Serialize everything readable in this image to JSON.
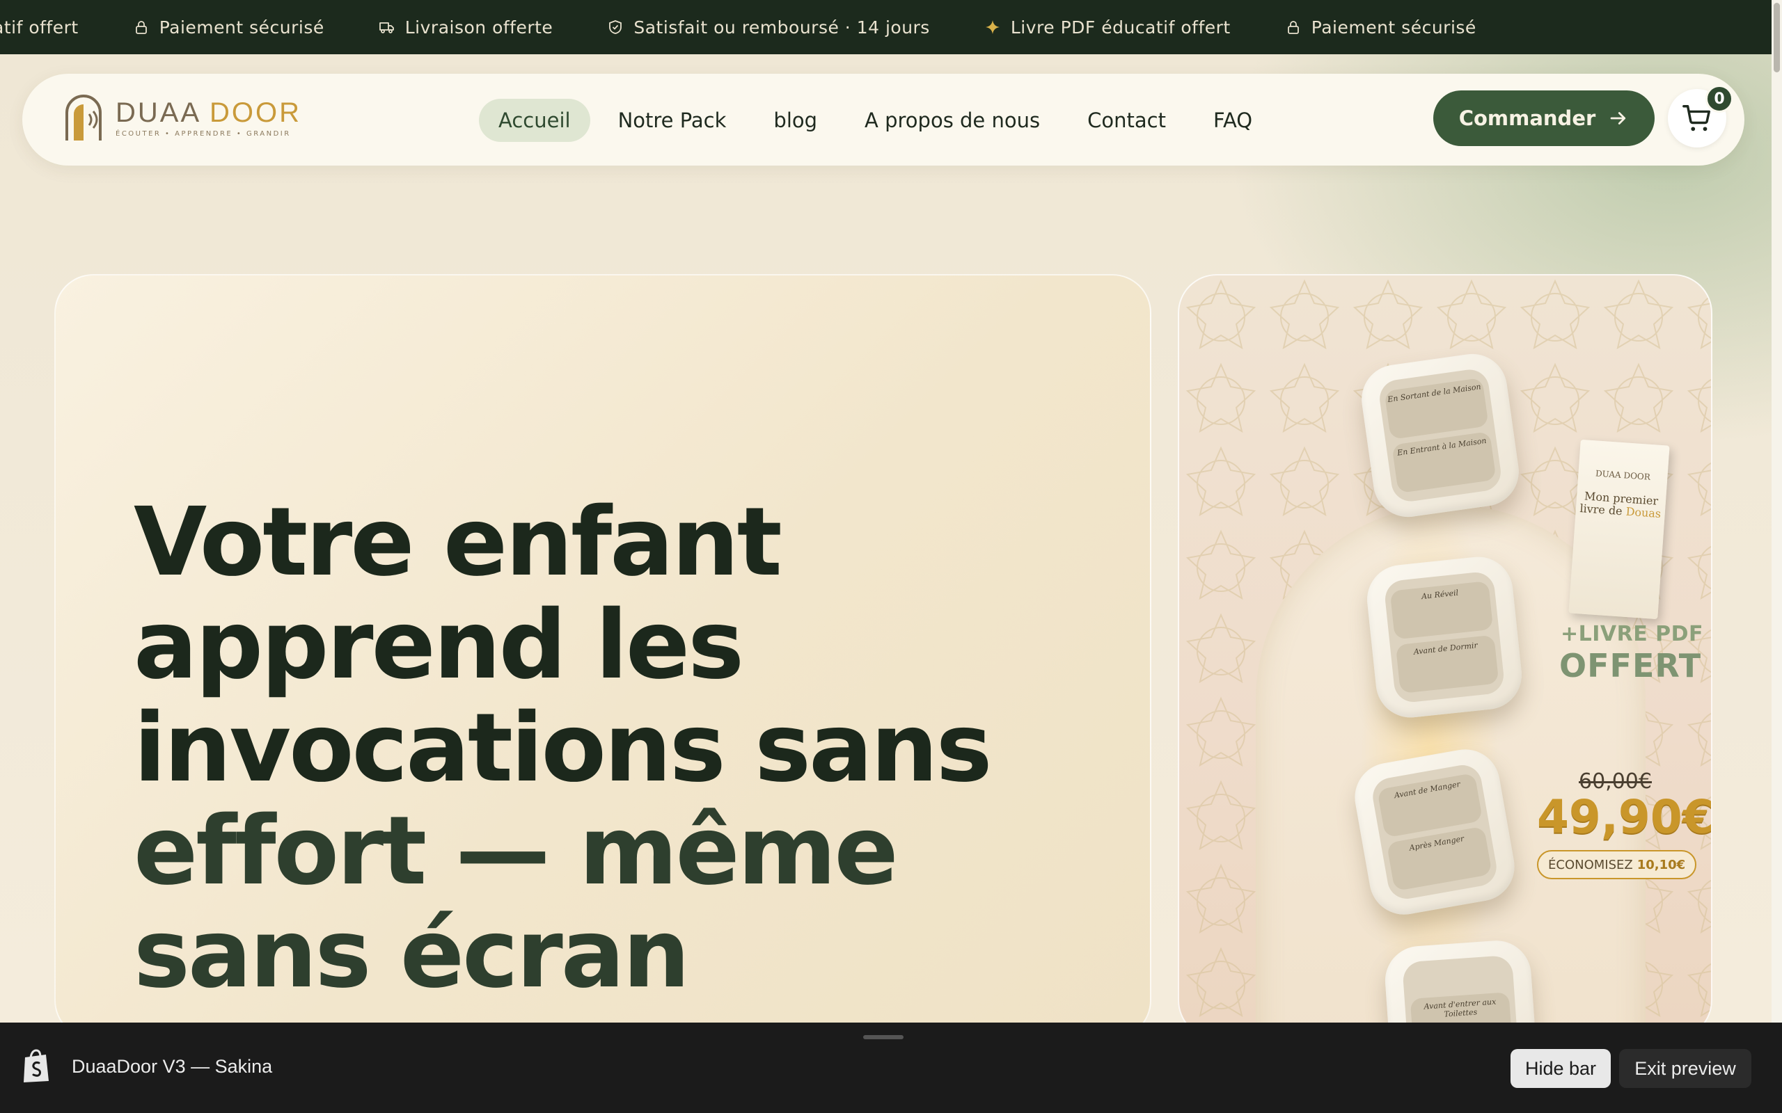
{
  "announcement": {
    "items": [
      {
        "icon": "book-icon",
        "text": "atif offert"
      },
      {
        "icon": "lock-icon",
        "text": "Paiement sécurisé"
      },
      {
        "icon": "truck-icon",
        "text": "Livraison offerte"
      },
      {
        "icon": "shield-check-icon",
        "text": "Satisfait ou remboursé · 14 jours"
      },
      {
        "icon": "sparkle-icon",
        "text": "Livre PDF éducatif offert"
      },
      {
        "icon": "lock-icon",
        "text": "Paiement sécurisé"
      }
    ]
  },
  "header": {
    "logo_word_a": "DUAA ",
    "logo_word_b": "DOOR",
    "logo_tagline": "ÉCOUTER • APPRENDRE • GRANDIR",
    "nav": [
      {
        "label": "Accueil",
        "active": true
      },
      {
        "label": "Notre Pack",
        "active": false
      },
      {
        "label": "blog",
        "active": false
      },
      {
        "label": "A propos de nous",
        "active": false
      },
      {
        "label": "Contact",
        "active": false
      },
      {
        "label": "FAQ",
        "active": false
      }
    ],
    "cta_label": "Commander",
    "cart_count": "0"
  },
  "hero": {
    "title_line1": "Votre enfant",
    "title_line2": "apprend les",
    "title_line3": "invocations sans",
    "title_line4": "effort — même",
    "title_line5": "sans écran"
  },
  "product": {
    "device_labels": [
      [
        "En Sortant de la Maison",
        "En Entrant à la Maison"
      ],
      [
        "Au Réveil",
        "Avant de Dormir"
      ],
      [
        "Avant de Manger",
        "Après Manger"
      ],
      [
        "Avant d'entrer aux Toilettes",
        ""
      ]
    ],
    "book_brand": "DUAA DOOR",
    "book_title_a": "Mon premier",
    "book_title_b": "livre de ",
    "book_title_c": "Douas",
    "pdf_plus": "+LIVRE PDF",
    "pdf_offert": "OFFERT",
    "old_price": "60,00€",
    "new_price": "49,90€",
    "save_label": "ÉCONOMISEZ",
    "save_amount": "10,10€"
  },
  "preview_bar": {
    "title": "DuaaDoor V3 — Sakina",
    "hide_label": "Hide bar",
    "exit_label": "Exit preview"
  },
  "colors": {
    "brand_green": "#3b5a3a",
    "brand_gold": "#c99a3a",
    "announcement_bg": "#1c2a1d"
  }
}
